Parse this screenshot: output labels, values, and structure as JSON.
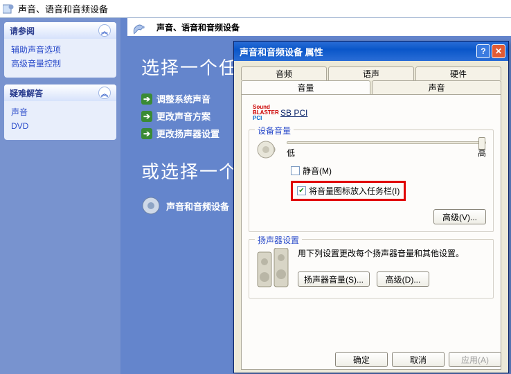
{
  "addressbar": {
    "title": "声音、语音和音频设备"
  },
  "sidebar": {
    "panel1": {
      "title": "请参阅",
      "items": [
        "辅助声音选项",
        "高级音量控制"
      ]
    },
    "panel2": {
      "title": "疑难解答",
      "items": [
        "声音",
        "DVD"
      ]
    }
  },
  "main": {
    "categoryHeader": "声音、语音和音频设备",
    "heading1": "选择一个任",
    "tasks": [
      "调整系统声音",
      "更改声音方案",
      "更改扬声器设置"
    ],
    "heading2": "或选择一个",
    "categoryItem": "声音和音频设备"
  },
  "dialog": {
    "title": "声音和音频设备 属性",
    "tabsTop": [
      "音频",
      "语声",
      "硬件"
    ],
    "tabsBottom": [
      "音量",
      "声音"
    ],
    "deviceLink": "SB PCI",
    "volumeGroup": {
      "legend": "设备音量",
      "lowLabel": "低",
      "highLabel": "高",
      "muteLabel": "静音(M)",
      "taskbarLabel": "将音量图标放入任务栏(I)",
      "advancedBtn": "高级(V)..."
    },
    "speakerGroup": {
      "legend": "扬声器设置",
      "desc": "用下列设置更改每个扬声器音量和其他设置。",
      "volBtn": "扬声器音量(S)...",
      "advBtn": "高级(D)..."
    },
    "buttons": {
      "ok": "确定",
      "cancel": "取消",
      "apply": "应用(A)"
    }
  }
}
